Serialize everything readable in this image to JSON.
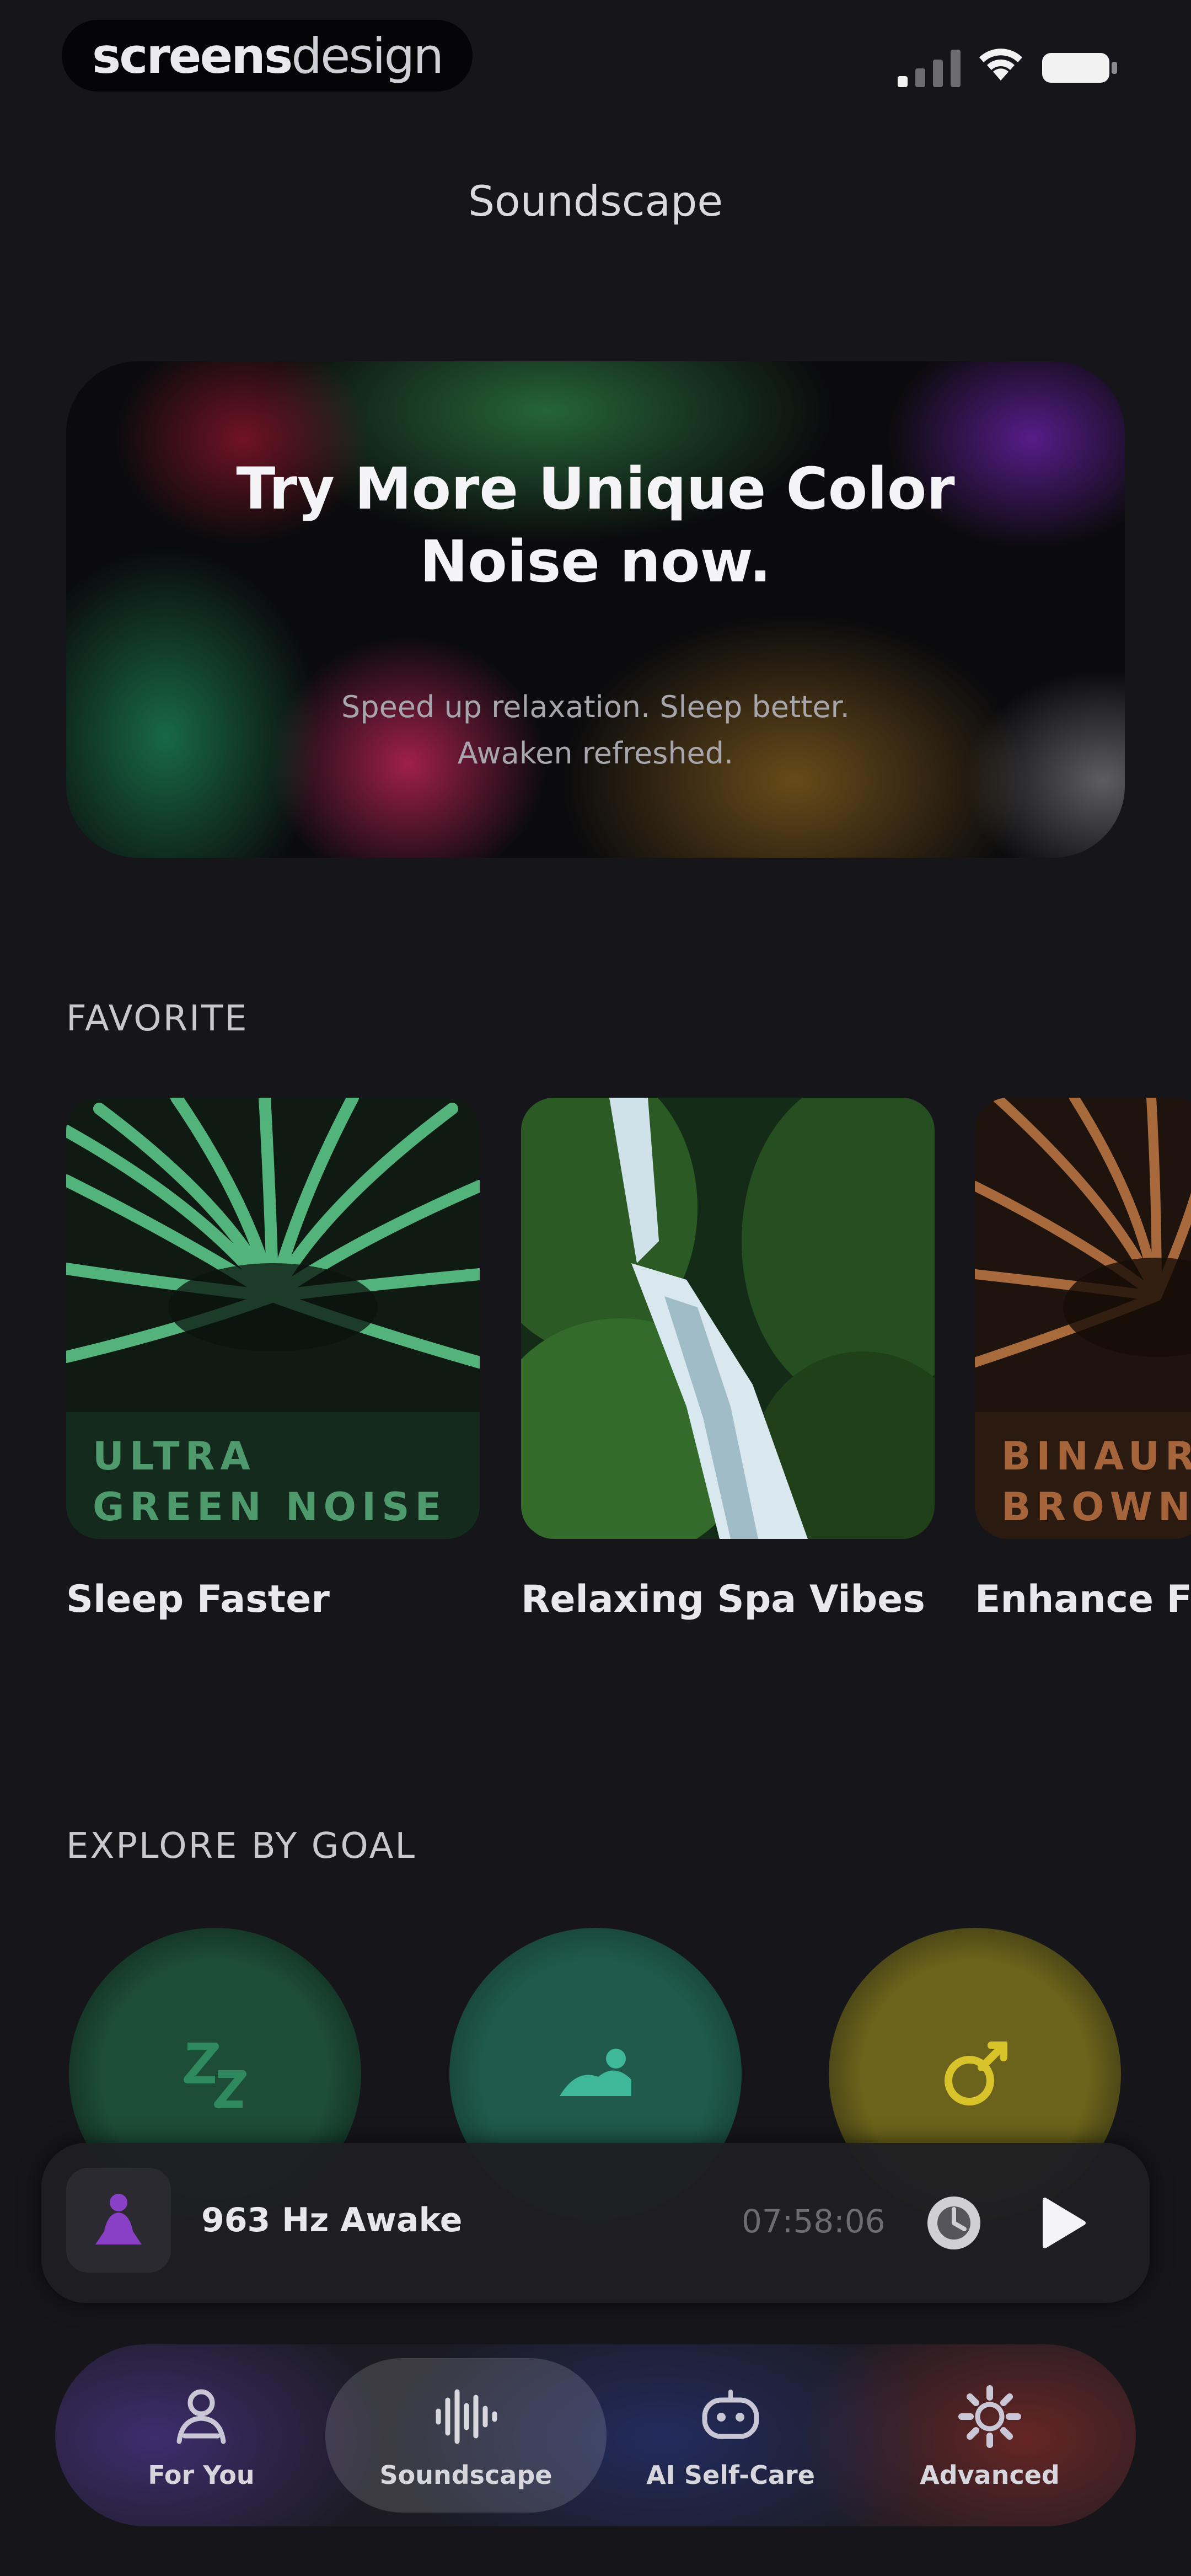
{
  "status_bar": {
    "brand_bold": "screens",
    "brand_light": "design"
  },
  "header": {
    "title": "Soundscape"
  },
  "promo": {
    "title": "Try More Unique Color\nNoise now.",
    "subtitle": "Speed up relaxation. Sleep better.\nAwaken refreshed."
  },
  "favorite": {
    "section_label": "FAVORITE",
    "items": [
      {
        "title": "Sleep Faster",
        "art_caption": "ULTRA\nGREEN NOISE",
        "caption_color": "#4e9a6c"
      },
      {
        "title": "Relaxing Spa Vibes"
      },
      {
        "title": "Enhance Fo",
        "art_caption": "BINAURA\nBROWN N",
        "caption_color": "#a6643a"
      }
    ]
  },
  "explore": {
    "section_label": "EXPLORE BY GOAL",
    "goals": [
      {
        "icon": "sleep-zz-icon",
        "color": "#2e8a5e"
      },
      {
        "icon": "relax-icon",
        "color": "#3fb89a"
      },
      {
        "icon": "focus-icon",
        "color": "#d8c32a"
      }
    ]
  },
  "player": {
    "title": "963 Hz Awake",
    "time": "07:58:06"
  },
  "tabs": [
    {
      "label": "For You",
      "icon": "meditation-icon"
    },
    {
      "label": "Soundscape",
      "icon": "waveform-icon",
      "active": true
    },
    {
      "label": "AI Self-Care",
      "icon": "robot-icon"
    },
    {
      "label": "Advanced",
      "icon": "gear-icon"
    }
  ]
}
